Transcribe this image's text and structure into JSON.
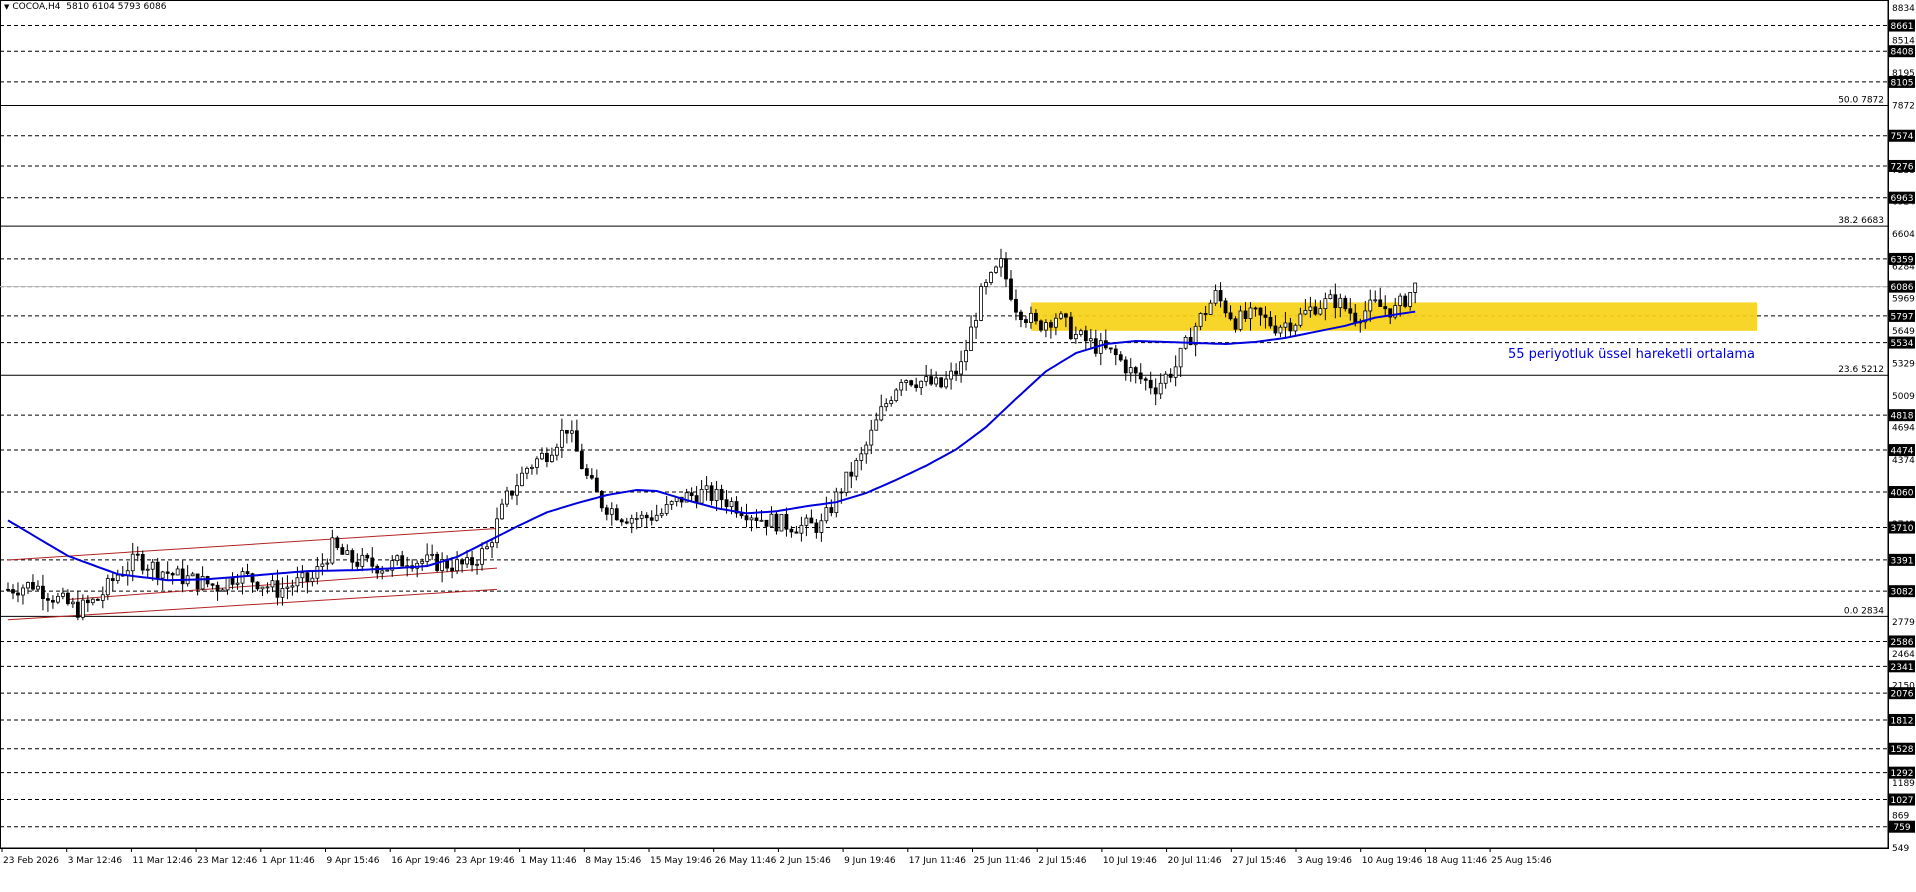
{
  "header": {
    "symbol": "COCOA,H4",
    "ohlc": "5810 6104 5793 6086"
  },
  "annotation": "55 periyotluk üssel hareketli ortalama",
  "colors": {
    "background": "#ffffff",
    "candle": "#000000",
    "ema": "#0000dd",
    "zone": "#f7d117",
    "channel": "#b22222",
    "grid": "#000000",
    "annotation": "#0000dd"
  },
  "chart_data": {
    "type": "candlestick",
    "title": "COCOA,H4",
    "ylim": [
      549,
      8834
    ],
    "price_axis_labels": [
      8834,
      8514,
      8195,
      7872,
      7555,
      7238,
      6924,
      6604,
      6284,
      5969,
      5649,
      5329,
      5009,
      4694,
      4374,
      4060,
      3743,
      3410,
      3100,
      2779,
      2464,
      2150,
      1830,
      1510,
      1189,
      869,
      549
    ],
    "boxed_levels": [
      8661,
      8408,
      8105,
      7574,
      7276,
      6963,
      6359,
      6086,
      5797,
      5534,
      4818,
      4474,
      4060,
      3710,
      3391,
      3082,
      2586,
      2341,
      2076,
      1812,
      1528,
      1292,
      1027,
      759
    ],
    "current_price": 6086,
    "fibonacci": [
      {
        "label": "50.0",
        "value": 7872
      },
      {
        "label": "38.2",
        "value": 6683
      },
      {
        "label": "23.6",
        "value": 5212
      },
      {
        "label": "0.0",
        "value": 2834
      }
    ],
    "support_zone": {
      "low": 5650,
      "high": 5930,
      "from": "2 Jul 15:46"
    },
    "time_labels": [
      "23 Feb 2026",
      "3 Mar 12:46",
      "11 Mar 12:46",
      "23 Mar 12:46",
      "1 Apr 11:46",
      "9 Apr 15:46",
      "16 Apr 19:46",
      "23 Apr 19:46",
      "1 May 11:46",
      "8 May 15:46",
      "15 May 19:46",
      "26 May 11:46",
      "2 Jun 15:46",
      "9 Jun 19:46",
      "17 Jun 11:46",
      "25 Jun 11:46",
      "2 Jul 15:46",
      "10 Jul 19:46",
      "20 Jul 11:46",
      "27 Jul 15:46",
      "3 Aug 19:46",
      "10 Aug 19:46",
      "18 Aug 11:46",
      "25 Aug 15:46"
    ],
    "price_path": [
      [
        0,
        3100
      ],
      [
        5,
        3150
      ],
      [
        10,
        3000
      ],
      [
        14,
        2900
      ],
      [
        18,
        3000
      ],
      [
        22,
        3250
      ],
      [
        26,
        3400
      ],
      [
        30,
        3300
      ],
      [
        34,
        3230
      ],
      [
        38,
        3180
      ],
      [
        42,
        3130
      ],
      [
        46,
        3250
      ],
      [
        50,
        3180
      ],
      [
        54,
        3090
      ],
      [
        57,
        3150
      ],
      [
        61,
        3200
      ],
      [
        65,
        3520
      ],
      [
        68,
        3400
      ],
      [
        72,
        3350
      ],
      [
        76,
        3320
      ],
      [
        80,
        3400
      ],
      [
        84,
        3370
      ],
      [
        88,
        3350
      ],
      [
        92,
        3330
      ],
      [
        96,
        3500
      ],
      [
        100,
        4000
      ],
      [
        104,
        4300
      ],
      [
        108,
        4450
      ],
      [
        112,
        4700
      ],
      [
        116,
        4200
      ],
      [
        119,
        3950
      ],
      [
        123,
        3830
      ],
      [
        127,
        3800
      ],
      [
        131,
        3850
      ],
      [
        135,
        4000
      ],
      [
        139,
        4050
      ],
      [
        143,
        4000
      ],
      [
        147,
        3900
      ],
      [
        151,
        3800
      ],
      [
        155,
        3750
      ],
      [
        159,
        3720
      ],
      [
        163,
        3730
      ],
      [
        167,
        4100
      ],
      [
        171,
        4400
      ],
      [
        175,
        4850
      ],
      [
        179,
        5200
      ],
      [
        183,
        5150
      ],
      [
        187,
        5100
      ],
      [
        191,
        5300
      ],
      [
        195,
        6000
      ],
      [
        199,
        6300
      ],
      [
        202,
        5900
      ],
      [
        206,
        5700
      ],
      [
        210,
        5800
      ],
      [
        214,
        5600
      ],
      [
        218,
        5500
      ],
      [
        222,
        5400
      ],
      [
        226,
        5200
      ],
      [
        230,
        5100
      ],
      [
        234,
        5300
      ],
      [
        238,
        5700
      ],
      [
        242,
        6000
      ],
      [
        246,
        5750
      ],
      [
        250,
        5800
      ],
      [
        254,
        5700
      ],
      [
        258,
        5750
      ],
      [
        262,
        5900
      ],
      [
        266,
        5950
      ],
      [
        270,
        5800
      ],
      [
        274,
        5900
      ],
      [
        278,
        5850
      ],
      [
        282,
        6086
      ]
    ],
    "ema_55": [
      [
        0,
        3780
      ],
      [
        12,
        3430
      ],
      [
        22,
        3250
      ],
      [
        32,
        3190
      ],
      [
        40,
        3200
      ],
      [
        50,
        3240
      ],
      [
        60,
        3280
      ],
      [
        70,
        3290
      ],
      [
        78,
        3310
      ],
      [
        84,
        3330
      ],
      [
        90,
        3420
      ],
      [
        96,
        3570
      ],
      [
        102,
        3720
      ],
      [
        108,
        3860
      ],
      [
        114,
        3950
      ],
      [
        120,
        4030
      ],
      [
        126,
        4080
      ],
      [
        130,
        4070
      ],
      [
        136,
        3980
      ],
      [
        142,
        3900
      ],
      [
        148,
        3850
      ],
      [
        154,
        3870
      ],
      [
        160,
        3920
      ],
      [
        166,
        3960
      ],
      [
        172,
        4050
      ],
      [
        178,
        4180
      ],
      [
        184,
        4320
      ],
      [
        190,
        4480
      ],
      [
        196,
        4700
      ],
      [
        202,
        4980
      ],
      [
        208,
        5250
      ],
      [
        214,
        5430
      ],
      [
        220,
        5520
      ],
      [
        226,
        5550
      ],
      [
        232,
        5540
      ],
      [
        238,
        5530
      ],
      [
        244,
        5520
      ],
      [
        250,
        5540
      ],
      [
        256,
        5580
      ],
      [
        262,
        5640
      ],
      [
        268,
        5700
      ],
      [
        274,
        5780
      ],
      [
        282,
        5840
      ]
    ],
    "channel_lines": [
      {
        "from": [
          0,
          3390
        ],
        "to": [
          98,
          3700
        ]
      },
      {
        "from": [
          0,
          2800
        ],
        "to": [
          98,
          3100
        ]
      },
      {
        "from": [
          12,
          3000
        ],
        "to": [
          98,
          3310
        ]
      }
    ]
  }
}
